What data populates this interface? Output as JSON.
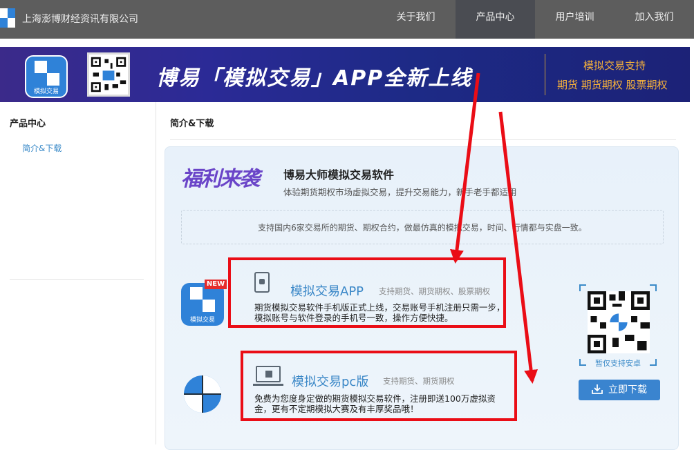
{
  "header": {
    "company": "上海澎博财经资讯有限公司",
    "nav": [
      "关于我们",
      "产品中心",
      "用户培训",
      "加入我们"
    ],
    "active_index": 1
  },
  "banner": {
    "app_icon_caption": "模拟交易",
    "headline": "博易「模拟交易」APP全新上线",
    "side_line1": "模拟交易支持",
    "side_line2": "期货 期货期权 股票期权"
  },
  "sidebar": {
    "title": "产品中心",
    "items": [
      "简介&下载"
    ]
  },
  "main": {
    "breadcrumb": "简介&下载",
    "welfare_art": "福利来袭",
    "title": "博易大师模拟交易软件",
    "subtitle": "体验期货期权市场虚拟交易，提升交易能力，新手老手都适用",
    "support_note": "支持国内6家交易所的期货、期权合约，做最仿真的模拟交易，时间、行情都与实盘一致。"
  },
  "products": [
    {
      "title": "模拟交易APP",
      "tag": "支持期货、期货期权、股票期权",
      "desc1": "期货模拟交易软件手机版正式上线，交易账号手机注册只需一步，",
      "desc2": "模拟账号与软件登录的手机号一致，操作方便快捷。",
      "badge": "NEW",
      "icon_caption": "模拟交易"
    },
    {
      "title": "模拟交易pc版",
      "tag": "支持期货、期货期权",
      "desc1": "免费为您度身定做的期货模拟交易软件，注册即送100万虚拟资",
      "desc2": "金，更有不定期模拟大赛及有丰厚奖品哦！"
    }
  ],
  "download": {
    "qr_caption": "暂仅支持安卓",
    "button_label": "立即下载"
  },
  "colors": {
    "nav_bg": "#5d5d5d",
    "accent_blue": "#3a87c7",
    "annotation_red": "#ea0d16"
  }
}
